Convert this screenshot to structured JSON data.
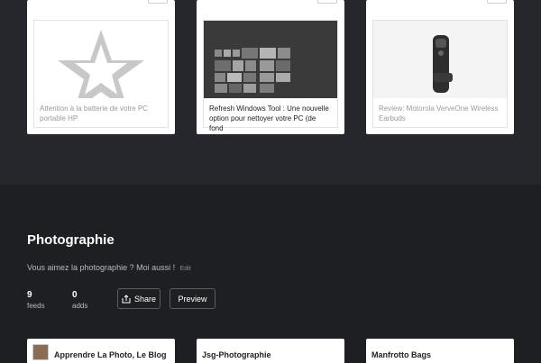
{
  "top_cards": [
    {
      "caption": "Attention à la batterie de votre PC portable HP",
      "thumb_icon": "star-icon"
    },
    {
      "caption": "Refresh Windows Tool : Une nouvelle option pour nettoyer votre PC (de fond",
      "thumb_icon": "windows-tiles-icon"
    },
    {
      "caption": "Review: Motorola VerveOne Wireless Earbuds",
      "thumb_icon": "earbud-icon"
    }
  ],
  "section": {
    "title": "Photographie",
    "description": "Vous aimez la photographie ? Moi aussi !",
    "edit_label": "Edit",
    "stats": [
      {
        "value": "9",
        "label": "feeds"
      },
      {
        "value": "0",
        "label": "adds"
      }
    ],
    "share_label": "Share",
    "preview_label": "Preview"
  },
  "feeds": [
    {
      "title": "Apprendre La Photo, Le Blog"
    },
    {
      "title": "Jsg-Photographie"
    },
    {
      "title": "Manfrotto Bags"
    }
  ],
  "colors": {
    "page_bg": "#1e1f22",
    "top_bg": "#25272c",
    "card_bg": "#ffffff"
  }
}
